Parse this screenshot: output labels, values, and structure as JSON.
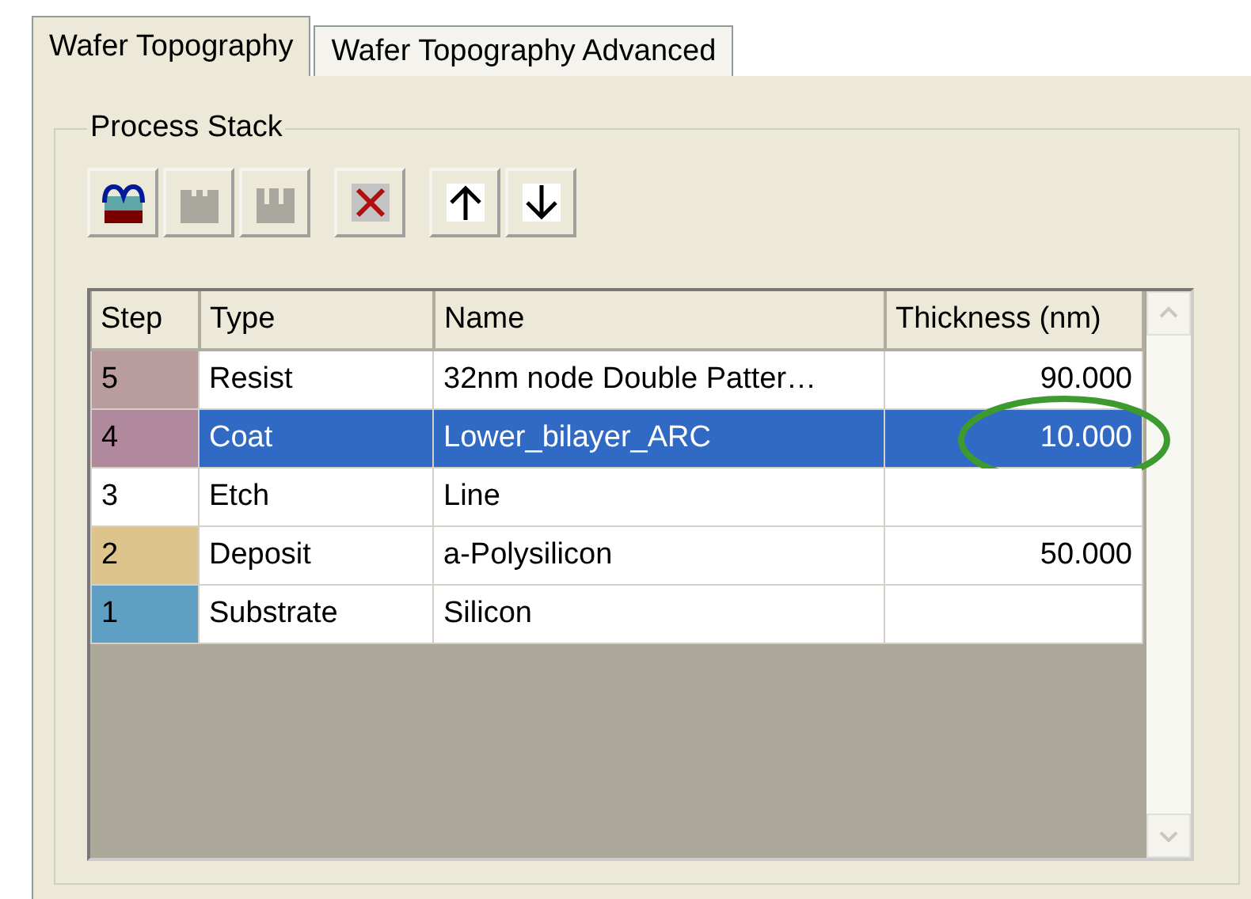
{
  "tabs": [
    {
      "label": "Wafer Topography",
      "selected": true
    },
    {
      "label": "Wafer Topography Advanced",
      "selected": false
    }
  ],
  "group": {
    "title": "Process Stack"
  },
  "toolbar": [
    {
      "kind": "layer",
      "disabled": false
    },
    {
      "kind": "etch-a",
      "disabled": true
    },
    {
      "kind": "etch-b",
      "disabled": true
    },
    {
      "kind": "delete",
      "disabled": false
    },
    {
      "kind": "up",
      "disabled": false
    },
    {
      "kind": "down",
      "disabled": false
    }
  ],
  "table": {
    "columns": [
      "Step",
      "Type",
      "Name",
      "Thickness (nm)"
    ],
    "rows": [
      {
        "step": "5",
        "type": "Resist",
        "name": "32nm node Double Patter…",
        "thickness": "90.000",
        "color": "#b89c9e",
        "selected": false,
        "circled": false
      },
      {
        "step": "4",
        "type": "Coat",
        "name": "Lower_bilayer_ARC",
        "thickness": "10.000",
        "color": "#b08a9c",
        "selected": true,
        "circled": true
      },
      {
        "step": "3",
        "type": "Etch",
        "name": "Line",
        "thickness": "",
        "color": "#ffffff",
        "selected": false,
        "circled": false
      },
      {
        "step": "2",
        "type": "Deposit",
        "name": "a-Polysilicon",
        "thickness": "50.000",
        "color": "#dcc48c",
        "selected": false,
        "circled": false
      },
      {
        "step": "1",
        "type": "Substrate",
        "name": "Silicon",
        "thickness": "",
        "color": "#5f9fc4",
        "selected": false,
        "circled": false
      }
    ]
  }
}
